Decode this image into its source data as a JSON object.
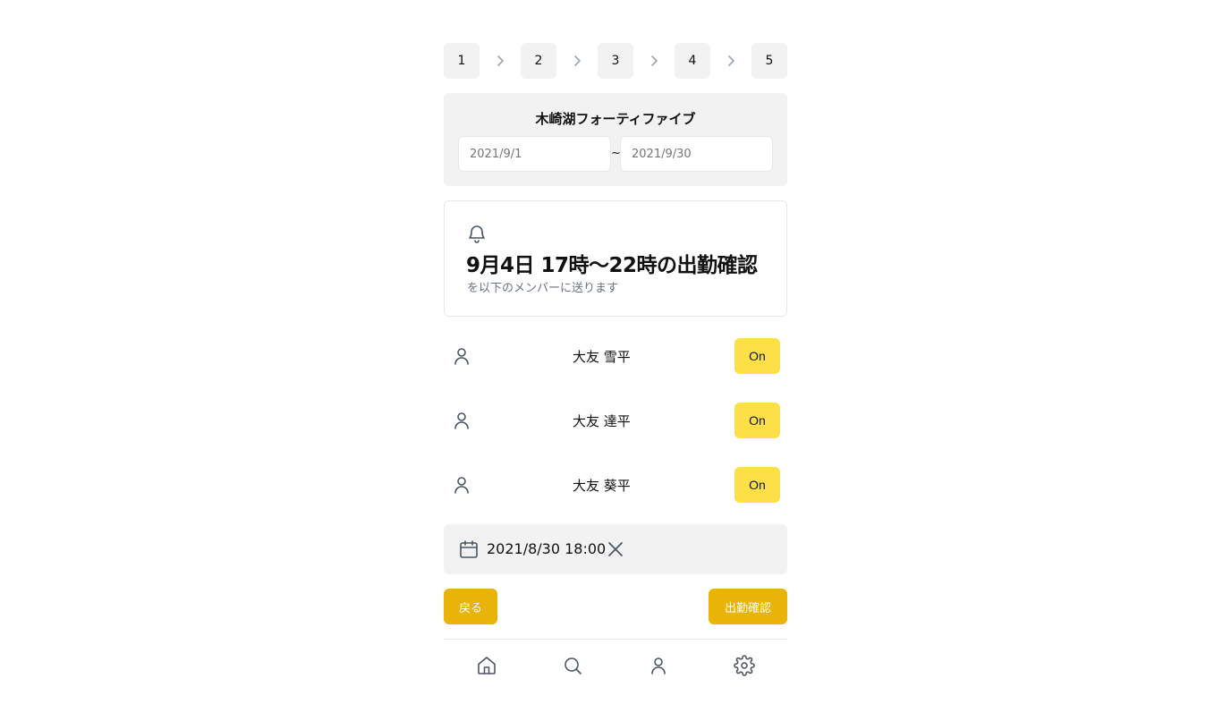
{
  "stepper": {
    "steps": [
      "1",
      "2",
      "3",
      "4",
      "5"
    ],
    "separator_icon": "chevron-right-icon"
  },
  "store": {
    "name": "木崎湖フォーティファイブ",
    "period_from_placeholder": "2021/9/1",
    "period_to_placeholder": "2021/9/30",
    "separator": "~"
  },
  "notice": {
    "icon": "bell-icon",
    "title": "9月4日 17時〜22時の出勤確認",
    "subtitle": "を以下のメンバーに送ります"
  },
  "members": [
    {
      "name": "大友 雪平",
      "toggle_label": "On",
      "icon": "user-icon"
    },
    {
      "name": "大友 達平",
      "toggle_label": "On",
      "icon": "user-icon"
    },
    {
      "name": "大友 葵平",
      "toggle_label": "On",
      "icon": "user-icon"
    }
  ],
  "schedule": {
    "icon": "calendar-icon",
    "datetime": "2021/8/30 18:00",
    "clear_icon": "close-icon"
  },
  "actions": {
    "back_label": "戻る",
    "confirm_label": "出勤確認"
  },
  "bottom_nav": {
    "items": [
      "home-icon",
      "search-icon",
      "user-icon",
      "gear-icon"
    ]
  },
  "colors": {
    "accent": "#eab308",
    "toggle_on": "#fde047",
    "panel_bg": "#f2f2f2",
    "border": "#e5e7eb",
    "icon": "#4b5563"
  }
}
